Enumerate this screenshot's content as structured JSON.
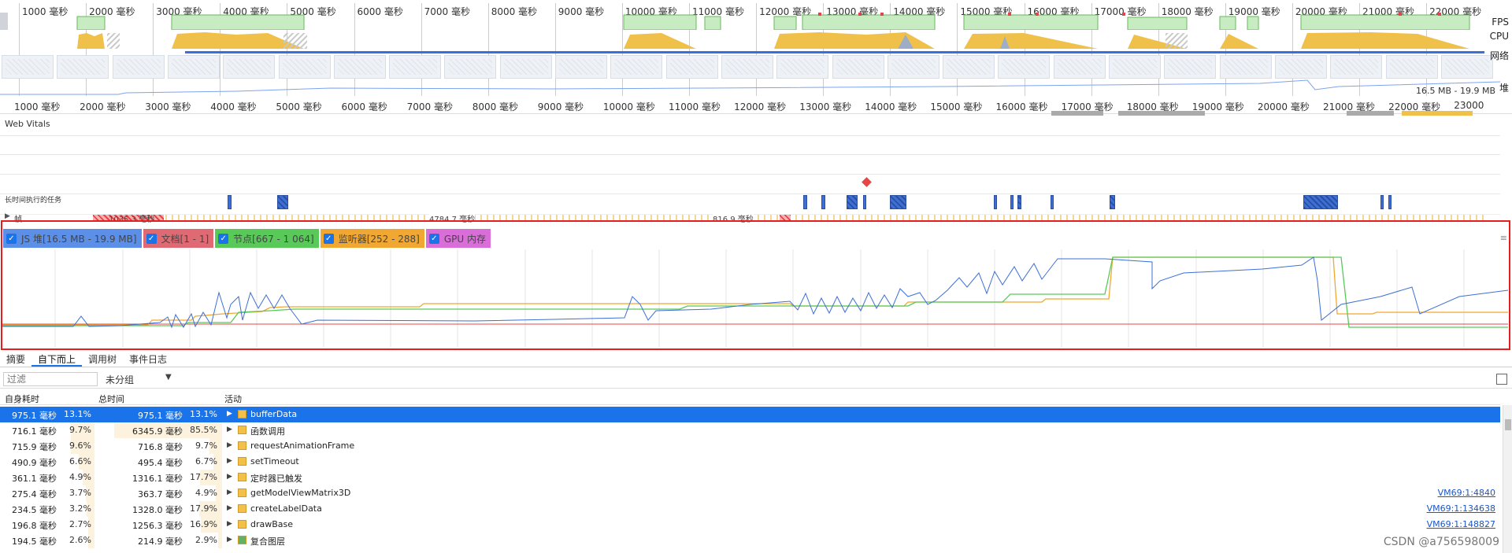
{
  "overview": {
    "ruler_ticks": [
      "1000 毫秒",
      "2000 毫秒",
      "3000 毫秒",
      "4000 毫秒",
      "5000 毫秒",
      "6000 毫秒",
      "7000 毫秒",
      "8000 毫秒",
      "9000 毫秒",
      "10000 毫秒",
      "11000 毫秒",
      "12000 毫秒",
      "13000 毫秒",
      "14000 毫秒",
      "15000 毫秒",
      "16000 毫秒",
      "17000 毫秒",
      "18000 毫秒",
      "19000 毫秒",
      "20000 毫秒",
      "21000 毫秒",
      "22000 毫秒"
    ],
    "track_labels": {
      "fps": "FPS",
      "cpu": "CPU",
      "network": "网络",
      "heap": "堆"
    },
    "heap_range": "16.5 MB - 19.9 MB"
  },
  "timeline": {
    "ruler_ticks": [
      "1000 毫秒",
      "2000 毫秒",
      "3000 毫秒",
      "4000 毫秒",
      "5000 毫秒",
      "6000 毫秒",
      "7000 毫秒",
      "8000 毫秒",
      "9000 毫秒",
      "10000 毫秒",
      "11000 毫秒",
      "12000 毫秒",
      "13000 毫秒",
      "14000 毫秒",
      "15000 毫秒",
      "16000 毫秒",
      "17000 毫秒",
      "18000 毫秒",
      "19000 毫秒",
      "20000 毫秒",
      "21000 毫秒",
      "22000 毫秒",
      "23000"
    ],
    "web_vitals_label": "Web Vitals",
    "long_tasks_label": "长时间执行的任务",
    "frames_label": "帧",
    "frame_durations": [
      "1035.3 毫秒",
      "4784.7 毫秒",
      "816.9 毫秒"
    ]
  },
  "memory": {
    "legend": [
      {
        "label": "JS 堆[16.5 MB - 19.9 MB]",
        "checked": true,
        "color": "#5b8fe8"
      },
      {
        "label": "文档[1 - 1]",
        "checked": true,
        "color": "#e06a73"
      },
      {
        "label": "节点[667 - 1 064]",
        "checked": true,
        "color": "#59c95a"
      },
      {
        "label": "监听器[252 - 288]",
        "checked": true,
        "color": "#f0a832"
      },
      {
        "label": "GPU 内存",
        "checked": true,
        "color": "#d96ed9"
      }
    ]
  },
  "tabs": [
    "摘要",
    "自下而上",
    "调用树",
    "事件日志"
  ],
  "active_tab": "自下而上",
  "filter": {
    "placeholder": "过滤",
    "group": "未分组"
  },
  "table": {
    "headers": {
      "self": "自身耗时",
      "total": "总时间",
      "activity": "活动"
    },
    "rows": [
      {
        "self": "975.1 毫秒",
        "self_pct": "13.1%",
        "total": "975.1 毫秒",
        "total_pct": "13.1%",
        "activity": "bufferData",
        "color": "#f3c04a",
        "link": "",
        "selected": true
      },
      {
        "self": "716.1 毫秒",
        "self_pct": "9.7%",
        "total": "6345.9 毫秒",
        "total_pct": "85.5%",
        "activity": "函数调用",
        "color": "#f3c04a",
        "link": ""
      },
      {
        "self": "715.9 毫秒",
        "self_pct": "9.6%",
        "total": "716.8 毫秒",
        "total_pct": "9.7%",
        "activity": "requestAnimationFrame",
        "color": "#f3c04a",
        "link": ""
      },
      {
        "self": "490.9 毫秒",
        "self_pct": "6.6%",
        "total": "495.4 毫秒",
        "total_pct": "6.7%",
        "activity": "setTimeout",
        "color": "#f3c04a",
        "link": ""
      },
      {
        "self": "361.1 毫秒",
        "self_pct": "4.9%",
        "total": "1316.1 毫秒",
        "total_pct": "17.7%",
        "activity": "定时器已触发",
        "color": "#f3c04a",
        "link": ""
      },
      {
        "self": "275.4 毫秒",
        "self_pct": "3.7%",
        "total": "363.7 毫秒",
        "total_pct": "4.9%",
        "activity": "getModelViewMatrix3D",
        "color": "#f3c04a",
        "link": "VM69:1:4840"
      },
      {
        "self": "234.5 毫秒",
        "self_pct": "3.2%",
        "total": "1328.0 毫秒",
        "total_pct": "17.9%",
        "activity": "createLabelData",
        "color": "#f3c04a",
        "link": "VM69:1:134638"
      },
      {
        "self": "196.8 毫秒",
        "self_pct": "2.7%",
        "total": "1256.3 毫秒",
        "total_pct": "16.9%",
        "activity": "drawBase",
        "color": "#f3c04a",
        "link": "VM69:1:148827"
      },
      {
        "self": "194.5 毫秒",
        "self_pct": "2.6%",
        "total": "214.9 毫秒",
        "total_pct": "2.9%",
        "activity": "复合图层",
        "color": "#64b064",
        "link": ""
      }
    ]
  },
  "watermark": "CSDN @a756598009"
}
